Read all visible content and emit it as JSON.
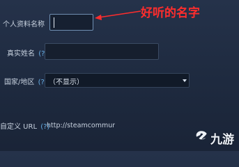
{
  "form": {
    "profile_name_label": "个人资料名称",
    "profile_name_value": "",
    "real_name_label": "真实姓名",
    "real_name_help": "(?)",
    "real_name_value": "",
    "country_label": "国家/地区",
    "country_help": "(?)",
    "country_selected": "（不显示）",
    "custom_url_label": "自定义 URL",
    "custom_url_help": "(?)",
    "custom_url_prefix": "http://steamcommunity.c"
  },
  "annotation": {
    "text": "好听的名字",
    "color": "#ff2d2d"
  },
  "watermark": {
    "text": "九游",
    "icon": "jiuyou-logo-icon"
  },
  "colors": {
    "background": "#1e2a3f",
    "field_background": "#161f2e",
    "help_link": "#68b1e8"
  }
}
